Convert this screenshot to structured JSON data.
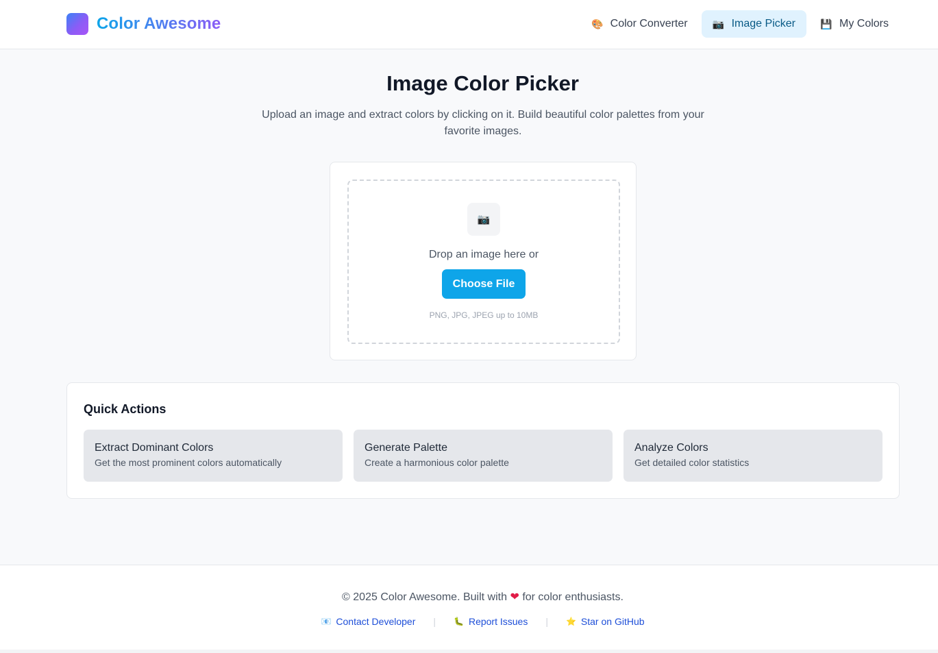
{
  "header": {
    "brand": "Color Awesome",
    "nav": [
      {
        "icon": "palette-icon",
        "glyph": "🎨",
        "label": "Color Converter",
        "active": false
      },
      {
        "icon": "camera-icon",
        "glyph": "📷",
        "label": "Image Picker",
        "active": true
      },
      {
        "icon": "floppy-disk-icon",
        "glyph": "💾",
        "label": "My Colors",
        "active": false
      }
    ]
  },
  "main": {
    "title": "Image Color Picker",
    "subtitle": "Upload an image and extract colors by clicking on it. Build beautiful color palettes from your favorite images.",
    "upload": {
      "icon": "camera-icon",
      "glyph": "📷",
      "prompt": "Drop an image here or",
      "button_label": "Choose File",
      "hint": "PNG, JPG, JPEG up to 10MB"
    },
    "quick_actions": {
      "title": "Quick Actions",
      "items": [
        {
          "name": "Extract Dominant Colors",
          "desc": "Get the most prominent colors automatically"
        },
        {
          "name": "Generate Palette",
          "desc": "Create a harmonious color palette"
        },
        {
          "name": "Analyze Colors",
          "desc": "Get detailed color statistics"
        }
      ]
    }
  },
  "footer": {
    "copy_before": "© 2025 Color Awesome. Built with",
    "heart": "❤",
    "copy_after": "for color enthusiasts.",
    "links": [
      {
        "icon": "email-icon",
        "glyph": "📧",
        "label": "Contact Developer"
      },
      {
        "icon": "bug-icon",
        "glyph": "🐛",
        "label": "Report Issues"
      },
      {
        "icon": "star-icon",
        "glyph": "⭐",
        "label": "Star on GitHub"
      }
    ]
  },
  "colors": {
    "accent": "#0ea5e9",
    "active_nav_bg": "#e0f2fe",
    "link": "#1d4ed8"
  }
}
